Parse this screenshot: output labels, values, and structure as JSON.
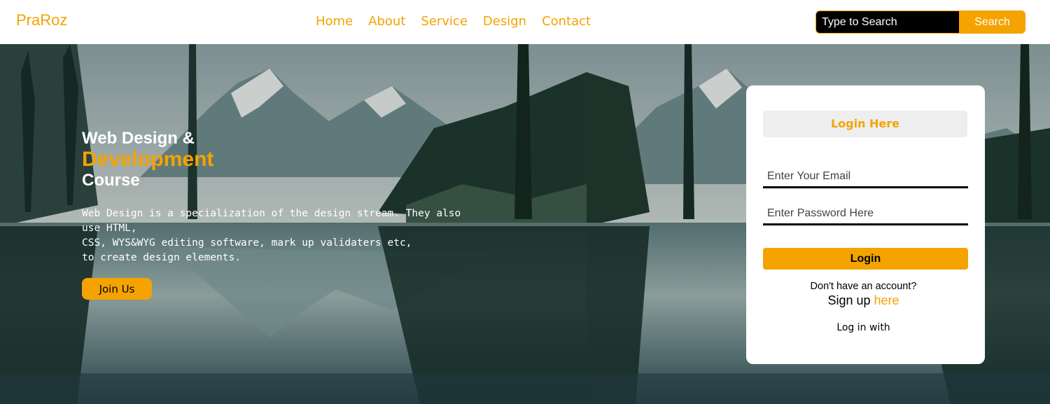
{
  "brand": "PraRoz",
  "nav": {
    "items": [
      {
        "label": "Home"
      },
      {
        "label": "About"
      },
      {
        "label": "Service"
      },
      {
        "label": "Design"
      },
      {
        "label": "Contact"
      }
    ]
  },
  "search": {
    "placeholder": "Type to Search",
    "button_label": "Search"
  },
  "hero": {
    "heading_line1": "Web Design &",
    "heading_line2": "Development",
    "heading_line3": "Course",
    "description_lines": [
      "Web Design is a specialization of the design stream. They also use HTML,",
      "CSS, WYS&WYG editing software, mark up validaters etc,",
      "to create design elements."
    ],
    "join_label": "Join Us"
  },
  "login": {
    "title": "Login Here",
    "email_placeholder": "Enter Your Email",
    "password_placeholder": "Enter Password Here",
    "button_label": "Login",
    "no_account_text": "Don't have an account?",
    "signup_prefix": "Sign up",
    "signup_link": "here",
    "login_with_text": "Log in with"
  },
  "colors": {
    "accent": "#f4a300",
    "background": "#ffffff",
    "search_bg": "#000000"
  }
}
